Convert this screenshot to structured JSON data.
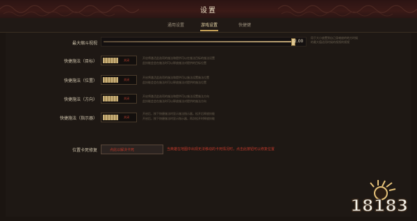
{
  "window": {
    "title": "设置"
  },
  "tabs": [
    {
      "label": "通用设置"
    },
    {
      "label": "游戏设置"
    },
    {
      "label": "快捷键"
    }
  ],
  "settings": {
    "max_zoom": {
      "label": "最大缩斗视视",
      "value": "2.00",
      "level": 0.92,
      "side_note": [
        "用于大小放置到自己身缩放的地方时候",
        "的最大值适用时候的视视的视视"
      ]
    },
    "quick_cast_target": {
      "label": "快捷施法（目标）",
      "toggle": "关闭",
      "desc": [
        "开启将激活此选项的施法和提供可以在施法目标的施法设置",
        "此技能会会在施法时可以释放施法对提供的目标位置"
      ]
    },
    "quick_cast_position": {
      "label": "快捷施法（位置）",
      "toggle": "关闭",
      "desc": [
        "开启将激活此选项的施法和提供可以施法设置施法位置",
        "此技能会会在施法时可以释放施法对提供的施法位置"
      ]
    },
    "quick_cast_direction": {
      "label": "快捷施法（方向）",
      "toggle": "关闭",
      "desc": [
        "开启将激活此选项的施法和提供可以施法设置施法方向",
        "此技能会会在施法时可以释放施法对提供的施法方向"
      ]
    },
    "quick_cast_indicator": {
      "label": "快捷施法（指示器）",
      "toggle": "关闭",
      "desc": [
        "开启后，按下快捷施法时显示施法指示器，松开后释放技能",
        "开启后，按下快捷施法时显示指示器，再次松开时释放技能"
      ]
    },
    "stuck_fix": {
      "label": "位置卡死修复",
      "button": "点此以解决卡死",
      "warning": "当英雄在地图中出现无法移动的卡死情况时，点击此按钮可以修复位置"
    }
  },
  "logo": {
    "text": "18183"
  },
  "colors": {
    "accent": "#c9a45a",
    "warning": "#c43a2c",
    "background": "#1b1511"
  }
}
